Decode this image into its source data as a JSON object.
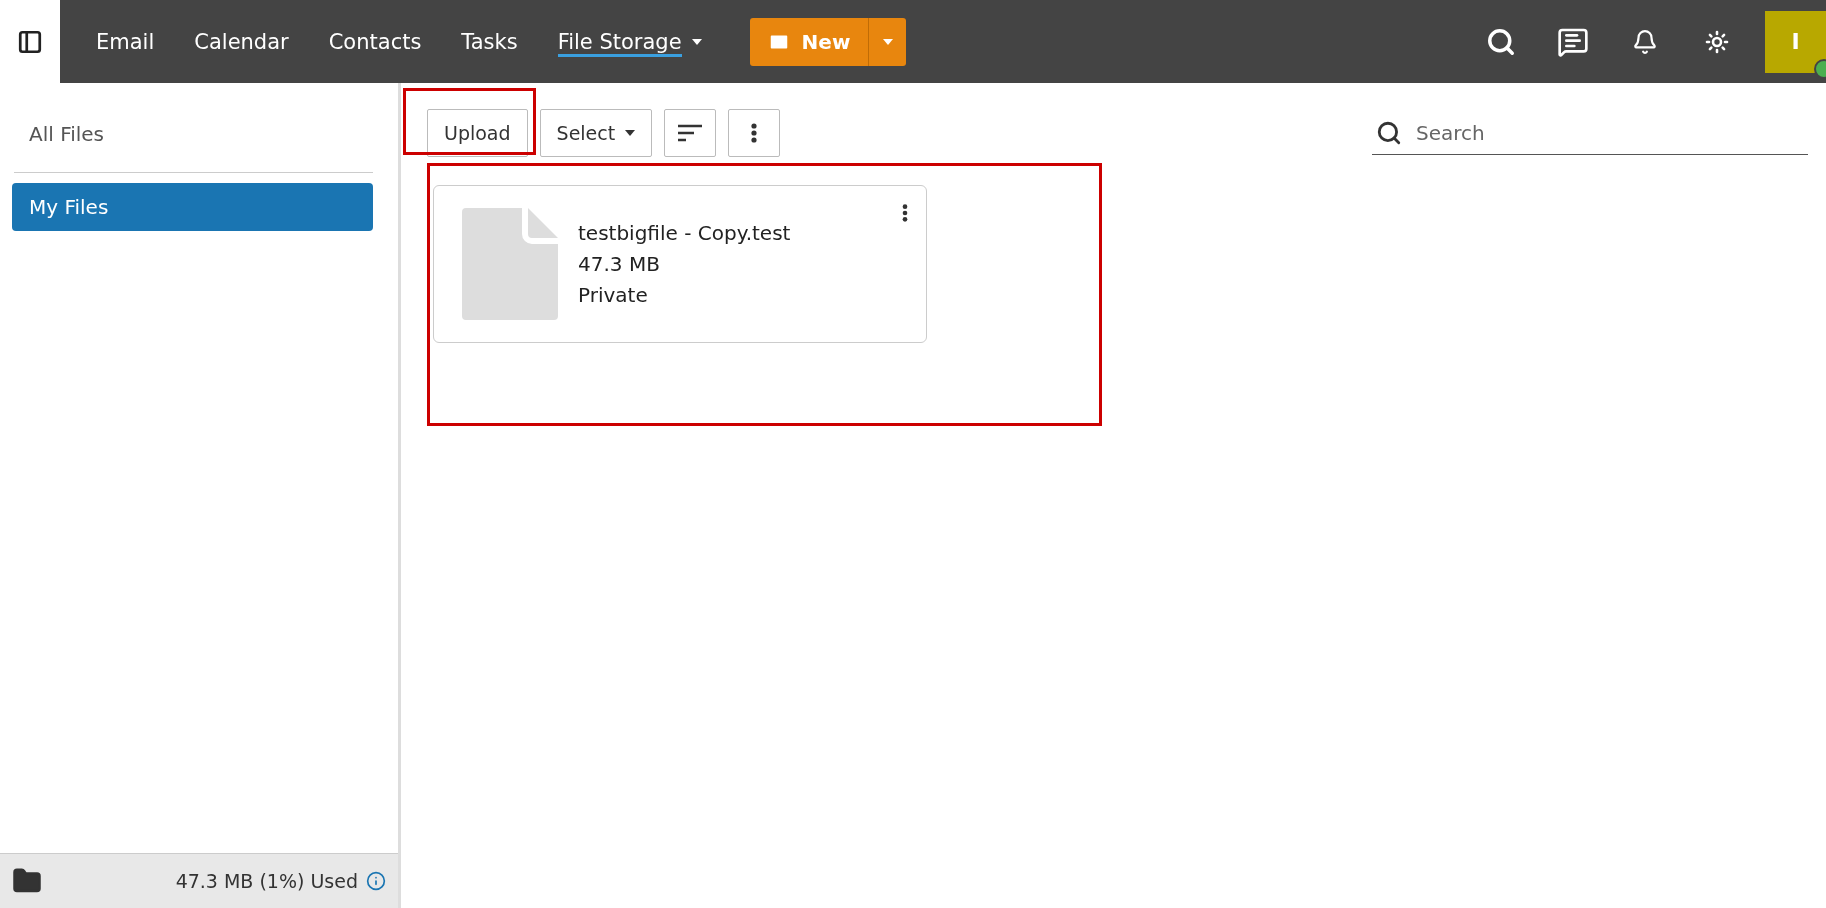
{
  "nav": {
    "items": [
      {
        "label": "Email",
        "selected": false,
        "dropdown": false
      },
      {
        "label": "Calendar",
        "selected": false,
        "dropdown": false
      },
      {
        "label": "Contacts",
        "selected": false,
        "dropdown": false
      },
      {
        "label": "Tasks",
        "selected": false,
        "dropdown": false
      },
      {
        "label": "File Storage",
        "selected": true,
        "dropdown": true
      }
    ]
  },
  "new_button": {
    "label": "New"
  },
  "avatar": {
    "initial": "I",
    "online": true
  },
  "sidebar": {
    "items": [
      {
        "label": "All Files",
        "selected": false
      },
      {
        "label": "My Files",
        "selected": true
      }
    ],
    "footer": {
      "usage": "47.3 MB (1%) Used"
    }
  },
  "toolbar": {
    "upload": {
      "label": "Upload",
      "highlighted": true
    },
    "select": {
      "label": "Select"
    }
  },
  "search": {
    "placeholder": "Search"
  },
  "files": {
    "highlighted": true,
    "items": [
      {
        "name": "testbigfile - Copy.test",
        "size": "47.3 MB",
        "sharing": "Private"
      }
    ]
  }
}
